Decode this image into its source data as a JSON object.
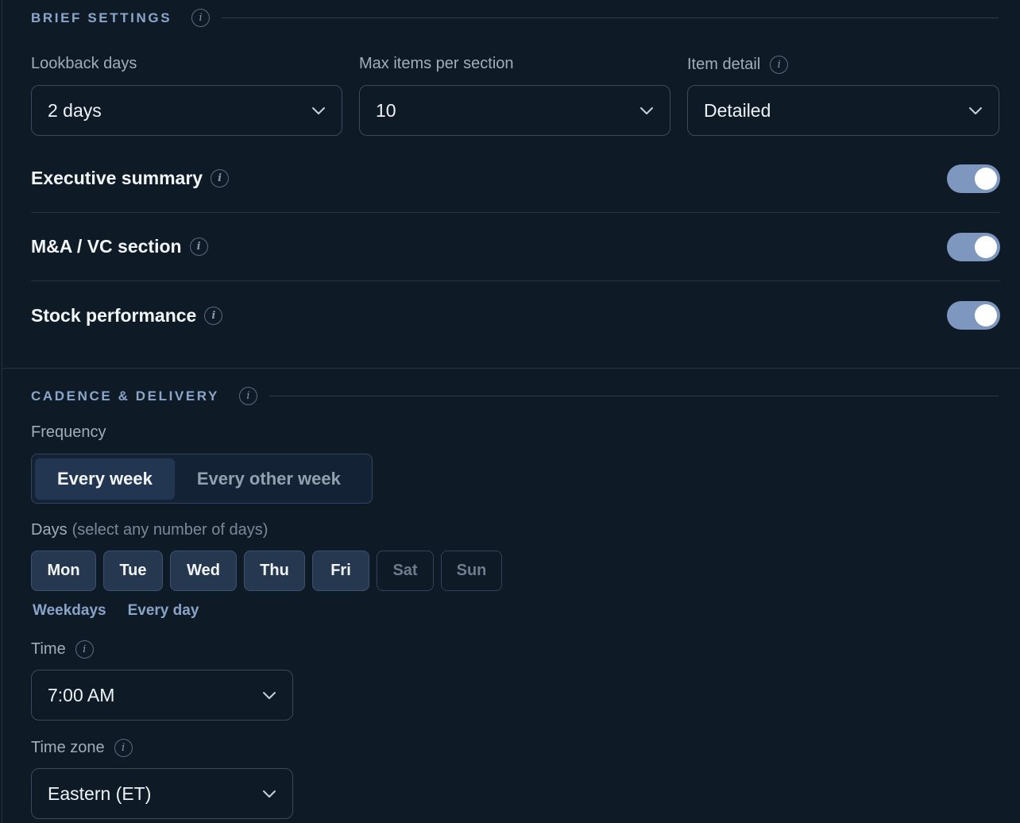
{
  "brief_settings": {
    "title": "BRIEF SETTINGS",
    "lookback": {
      "label": "Lookback days",
      "value": "2 days"
    },
    "max_items": {
      "label": "Max items per section",
      "value": "10"
    },
    "item_detail": {
      "label": "Item detail",
      "value": "Detailed"
    },
    "toggles": [
      {
        "label": "Executive summary",
        "on": true
      },
      {
        "label": "M&A / VC section",
        "on": true
      },
      {
        "label": "Stock performance",
        "on": true
      }
    ]
  },
  "cadence": {
    "title": "CADENCE & DELIVERY",
    "frequency": {
      "label": "Frequency",
      "options": [
        "Every week",
        "Every other week"
      ],
      "selected": "Every week"
    },
    "days": {
      "label": "Days",
      "hint": "(select any number of days)",
      "items": [
        {
          "label": "Mon",
          "selected": true
        },
        {
          "label": "Tue",
          "selected": true
        },
        {
          "label": "Wed",
          "selected": true
        },
        {
          "label": "Thu",
          "selected": true
        },
        {
          "label": "Fri",
          "selected": true
        },
        {
          "label": "Sat",
          "selected": false
        },
        {
          "label": "Sun",
          "selected": false
        }
      ],
      "quick_links": [
        "Weekdays",
        "Every day"
      ]
    },
    "time": {
      "label": "Time",
      "value": "7:00 AM"
    },
    "timezone": {
      "label": "Time zone",
      "value": "Eastern (ET)"
    }
  },
  "info_glyph": "i",
  "icons": {
    "info": "info-icon",
    "dropdown": "chevron-down-icon"
  },
  "colors": {
    "background": "#0f1a27",
    "accent": "#8ca6c9",
    "toggle_on": "#7d97bf",
    "day_selected": "#26384f"
  }
}
